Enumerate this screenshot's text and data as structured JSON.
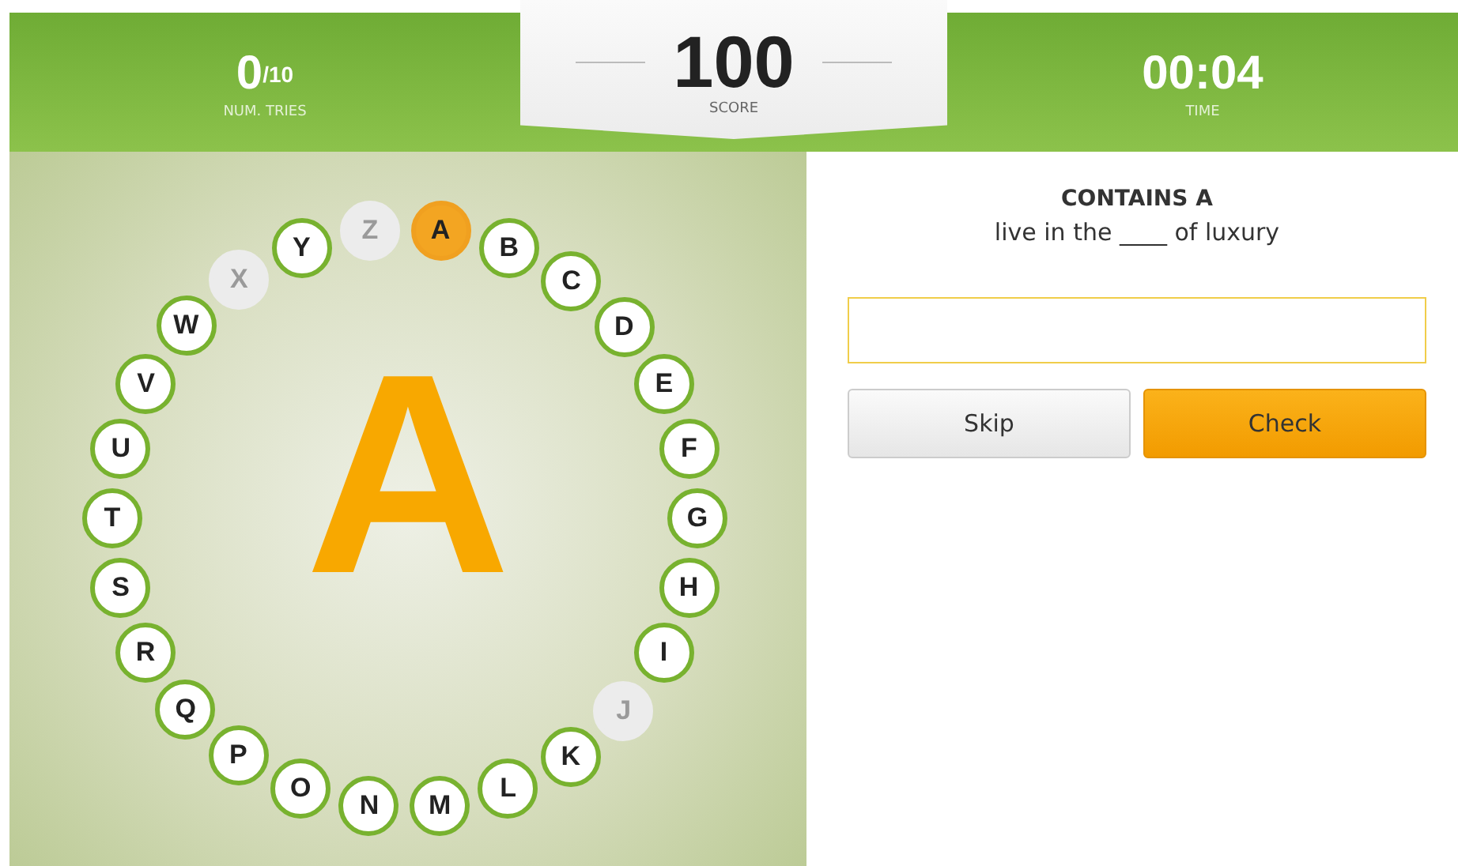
{
  "stats": {
    "tries": {
      "value": "0",
      "max": "/10",
      "label": "NUM. TRIES"
    },
    "score": {
      "value": "100",
      "label": "SCORE"
    },
    "time": {
      "value": "00:04",
      "label": "TIME"
    }
  },
  "current_letter": "A",
  "letters": [
    {
      "letter": "A",
      "current": true,
      "used": false
    },
    {
      "letter": "B",
      "current": false,
      "used": false
    },
    {
      "letter": "C",
      "current": false,
      "used": false
    },
    {
      "letter": "D",
      "current": false,
      "used": false
    },
    {
      "letter": "E",
      "current": false,
      "used": false
    },
    {
      "letter": "F",
      "current": false,
      "used": false
    },
    {
      "letter": "G",
      "current": false,
      "used": false
    },
    {
      "letter": "H",
      "current": false,
      "used": false
    },
    {
      "letter": "I",
      "current": false,
      "used": false
    },
    {
      "letter": "J",
      "current": false,
      "used": true
    },
    {
      "letter": "K",
      "current": false,
      "used": false
    },
    {
      "letter": "L",
      "current": false,
      "used": false
    },
    {
      "letter": "M",
      "current": false,
      "used": false
    },
    {
      "letter": "N",
      "current": false,
      "used": false
    },
    {
      "letter": "O",
      "current": false,
      "used": false
    },
    {
      "letter": "P",
      "current": false,
      "used": false
    },
    {
      "letter": "Q",
      "current": false,
      "used": false
    },
    {
      "letter": "R",
      "current": false,
      "used": false
    },
    {
      "letter": "S",
      "current": false,
      "used": false
    },
    {
      "letter": "T",
      "current": false,
      "used": false
    },
    {
      "letter": "U",
      "current": false,
      "used": false
    },
    {
      "letter": "V",
      "current": false,
      "used": false
    },
    {
      "letter": "W",
      "current": false,
      "used": false
    },
    {
      "letter": "X",
      "current": false,
      "used": true
    },
    {
      "letter": "Y",
      "current": false,
      "used": false
    },
    {
      "letter": "Z",
      "current": false,
      "used": true
    }
  ],
  "question": {
    "title": "CONTAINS A",
    "clue": "live in the ____ of luxury"
  },
  "buttons": [
    {
      "label": "Skip",
      "kind": "secondary"
    },
    {
      "label": "Check",
      "kind": "primary"
    }
  ]
}
